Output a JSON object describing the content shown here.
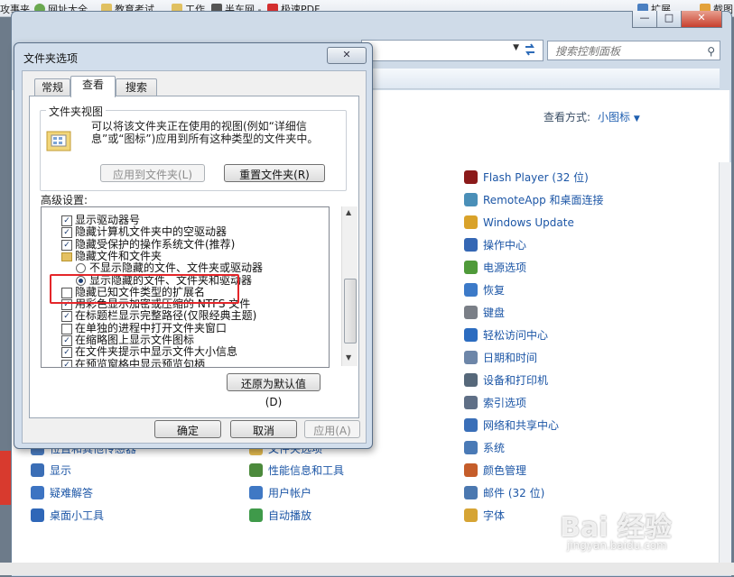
{
  "browser_bar": {
    "items": [
      "攻事夹",
      "网址大全",
      "教育考试",
      "工作",
      "半车网 -",
      "极速PDF"
    ],
    "right_items": [
      "扩展",
      "截图"
    ]
  },
  "explorer": {
    "search_placeholder": "搜索控制面板",
    "view_by_label": "查看方式:",
    "view_by_value": "小图标",
    "items_col1": [
      {
        "label": "位置和其他传感器",
        "icon": "sensor-icon",
        "color": "#4a7bc0"
      },
      {
        "label": "显示",
        "icon": "display-icon",
        "color": "#3b6eb6"
      },
      {
        "label": "疑难解答",
        "icon": "troubleshoot-icon",
        "color": "#3d74c2"
      },
      {
        "label": "桌面小工具",
        "icon": "gadget-icon",
        "color": "#2f67b8"
      }
    ],
    "items_col2": [
      {
        "label": "文件夹选项",
        "icon": "folder-options-icon",
        "color": "#e0b850"
      },
      {
        "label": "性能信息和工具",
        "icon": "performance-icon",
        "color": "#4c8a3c"
      },
      {
        "label": "用户帐户",
        "icon": "user-accounts-icon",
        "color": "#3f78c4"
      },
      {
        "label": "自动播放",
        "icon": "autoplay-icon",
        "color": "#3f9a4a"
      }
    ],
    "items_col3": [
      {
        "label": "Flash Player (32 位)",
        "icon": "flash-icon",
        "color": "#8b1a1a"
      },
      {
        "label": "RemoteApp 和桌面连接",
        "icon": "remoteapp-icon",
        "color": "#4a8fb8"
      },
      {
        "label": "Windows Update",
        "icon": "windows-update-icon",
        "color": "#d9a22a"
      },
      {
        "label": "操作中心",
        "icon": "action-center-icon",
        "color": "#3567b4"
      },
      {
        "label": "电源选项",
        "icon": "power-icon",
        "color": "#4f9a3a"
      },
      {
        "label": "恢复",
        "icon": "recovery-icon",
        "color": "#3c7ac8"
      },
      {
        "label": "键盘",
        "icon": "keyboard-icon",
        "color": "#7a7f87"
      },
      {
        "label": "轻松访问中心",
        "icon": "ease-access-icon",
        "color": "#2c6cc0"
      },
      {
        "label": "日期和时间",
        "icon": "datetime-icon",
        "color": "#6d86a8"
      },
      {
        "label": "设备和打印机",
        "icon": "printer-icon",
        "color": "#56687a"
      },
      {
        "label": "索引选项",
        "icon": "indexing-icon",
        "color": "#5f6f86"
      },
      {
        "label": "网络和共享中心",
        "icon": "network-icon",
        "color": "#3a6fb8"
      },
      {
        "label": "系统",
        "icon": "system-icon",
        "color": "#4a7ab6"
      },
      {
        "label": "颜色管理",
        "icon": "color-mgmt-icon",
        "color": "#c55d2a"
      },
      {
        "label": "邮件 (32 位)",
        "icon": "mail-icon",
        "color": "#4b78b0"
      },
      {
        "label": "字体",
        "icon": "fonts-icon",
        "color": "#d6a434"
      }
    ]
  },
  "dialog": {
    "title": "文件夹选项",
    "tabs": [
      "常规",
      "查看",
      "搜索"
    ],
    "group_title": "文件夹视图",
    "group_desc": "可以将该文件夹正在使用的视图(例如“详细信息”或“图标”)应用到所有这种类型的文件夹中。",
    "apply_to_folders": "应用到文件夹(L)",
    "reset_folders": "重置文件夹(R)",
    "advanced_label": "高级设置:",
    "settings": [
      {
        "type": "check",
        "checked": true,
        "indent": 0,
        "label": "显示驱动器号"
      },
      {
        "type": "check",
        "checked": true,
        "indent": 0,
        "label": "隐藏计算机文件夹中的空驱动器"
      },
      {
        "type": "check",
        "checked": true,
        "indent": 0,
        "label": "隐藏受保护的操作系统文件(推荐)"
      },
      {
        "type": "folder",
        "indent": 0,
        "label": "隐藏文件和文件夹"
      },
      {
        "type": "radio",
        "checked": false,
        "indent": 1,
        "label": "不显示隐藏的文件、文件夹或驱动器"
      },
      {
        "type": "radio",
        "checked": true,
        "indent": 1,
        "label": "显示隐藏的文件、文件夹和驱动器"
      },
      {
        "type": "check",
        "checked": false,
        "indent": 0,
        "label": "隐藏已知文件类型的扩展名"
      },
      {
        "type": "check",
        "checked": true,
        "indent": 0,
        "label": "用彩色显示加密或压缩的 NTFS 文件"
      },
      {
        "type": "check",
        "checked": true,
        "indent": 0,
        "label": "在标题栏显示完整路径(仅限经典主题)"
      },
      {
        "type": "check",
        "checked": false,
        "indent": 0,
        "label": "在单独的进程中打开文件夹窗口"
      },
      {
        "type": "check",
        "checked": true,
        "indent": 0,
        "label": "在缩略图上显示文件图标"
      },
      {
        "type": "check",
        "checked": true,
        "indent": 0,
        "label": "在文件夹提示中显示文件大小信息"
      },
      {
        "type": "check",
        "checked": true,
        "indent": 0,
        "label": "在预览窗格中显示预览句柄"
      }
    ],
    "restore_defaults": "还原为默认值(D)",
    "ok": "确定",
    "cancel": "取消",
    "apply": "应用(A)"
  },
  "watermark": {
    "logo": "Bai 经验",
    "url": "jingyan.baidu.com"
  }
}
